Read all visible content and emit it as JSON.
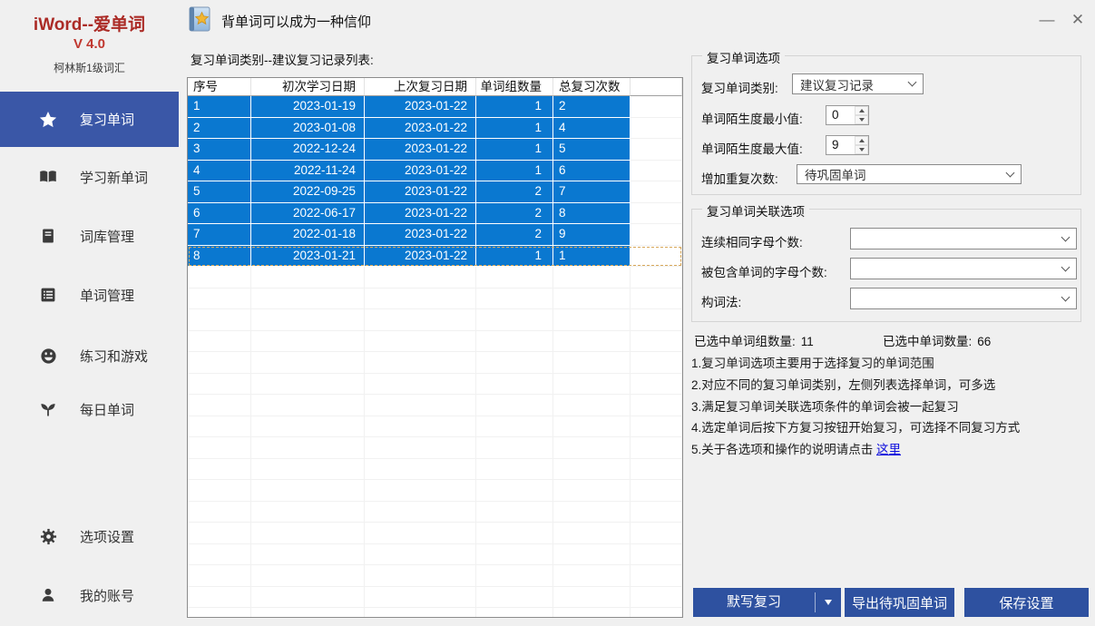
{
  "window": {
    "caption": "背单词可以成为一种信仰",
    "minimize_glyph": "—",
    "close_glyph": "✕"
  },
  "sidebar": {
    "app_title": "iWord--爱单词",
    "version": "V 4.0",
    "lexicon": "柯林斯1级词汇",
    "items": [
      {
        "key": "review-words",
        "icon": "star",
        "label": "复习单词",
        "active": true
      },
      {
        "key": "learn-new-words",
        "icon": "open-book",
        "label": "学习新单词"
      },
      {
        "key": "lexicon-management",
        "icon": "book",
        "label": "词库管理"
      },
      {
        "key": "word-management",
        "icon": "list",
        "label": "单词管理"
      },
      {
        "key": "practice-games",
        "icon": "smiley",
        "label": "练习和游戏"
      },
      {
        "key": "daily-words",
        "icon": "sprout",
        "label": "每日单词"
      },
      {
        "key": "settings",
        "icon": "gear",
        "label": "选项设置"
      },
      {
        "key": "my-account",
        "icon": "user",
        "label": "我的账号"
      }
    ]
  },
  "main": {
    "list_label": "复习单词类别--建议复习记录列表:",
    "table": {
      "columns": [
        "序号",
        "初次学习日期",
        "上次复习日期",
        "单词组数量",
        "总复习次数"
      ],
      "rows": [
        [
          "1",
          "2023-01-19",
          "2023-01-22",
          "1",
          "2"
        ],
        [
          "2",
          "2023-01-08",
          "2023-01-22",
          "1",
          "4"
        ],
        [
          "3",
          "2022-12-24",
          "2023-01-22",
          "1",
          "5"
        ],
        [
          "4",
          "2022-11-24",
          "2023-01-22",
          "1",
          "6"
        ],
        [
          "5",
          "2022-09-25",
          "2023-01-22",
          "2",
          "7"
        ],
        [
          "6",
          "2022-06-17",
          "2023-01-22",
          "2",
          "8"
        ],
        [
          "7",
          "2022-01-18",
          "2023-01-22",
          "2",
          "9"
        ],
        [
          "8",
          "2023-01-21",
          "2023-01-22",
          "1",
          "1"
        ]
      ],
      "selected_row_indexes": [
        0,
        1,
        2,
        3,
        4,
        5,
        6,
        7
      ],
      "focused_row_index": 7
    }
  },
  "options_panel": {
    "group1": {
      "legend": "复习单词选项",
      "category_label": "复习单词类别:",
      "category_value": "建议复习记录",
      "min_label": "单词陌生度最小值:",
      "min_value": "0",
      "max_label": "单词陌生度最大值:",
      "max_value": "9",
      "repeat_label": "增加重复次数:",
      "repeat_value": "待巩固单词"
    },
    "group2": {
      "legend": "复习单词关联选项",
      "same_letters_label": "连续相同字母个数:",
      "same_letters_value": "",
      "contained_label": "被包含单词的字母个数:",
      "contained_value": "",
      "formation_label": "构词法:",
      "formation_value": ""
    },
    "status": {
      "groups_label": "已选中单词组数量:",
      "groups_value": "11",
      "words_label": "已选中单词数量:",
      "words_value": "66"
    },
    "instructions": [
      "1.复习单词选项主要用于选择复习的单词范围",
      "2.对应不同的复习单词类别，左侧列表选择单词，可多选",
      "3.满足复习单词关联选项条件的单词会被一起复习",
      "4.选定单词后按下方复习按钮开始复习，可选择不同复习方式",
      "5.关于各选项和操作的说明请点击 "
    ],
    "help_link": "这里",
    "buttons": {
      "review": "默写复习",
      "export": "导出待巩固单词",
      "save": "保存设置"
    }
  },
  "colors": {
    "accent_button_blue": "#2e51a0",
    "sidebar_active_blue": "#3a57a7",
    "selection_blue": "#0a78d0",
    "title_red": "#ab2b26",
    "link_blue": "#0b0bdd",
    "window_bg": "#f0f0f0"
  }
}
